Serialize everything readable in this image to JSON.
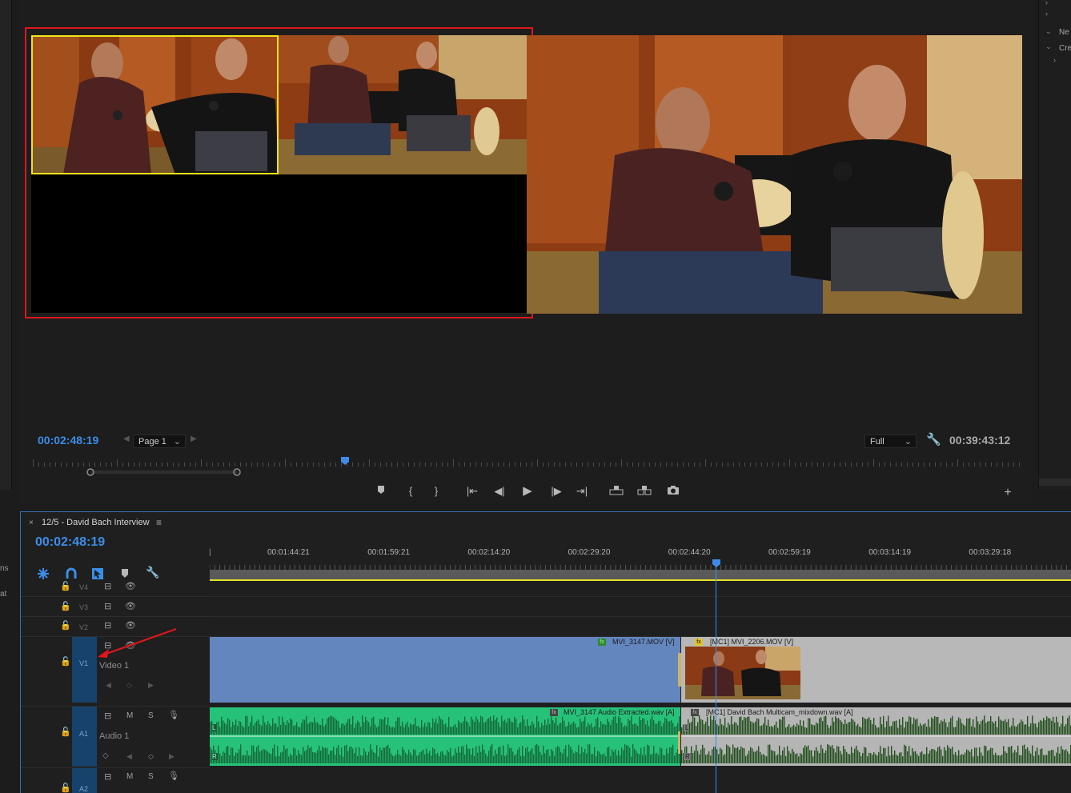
{
  "right_panel": {
    "items": [
      {
        "label": "Ne"
      },
      {
        "label": "Cre"
      }
    ]
  },
  "program_monitor": {
    "timecode_current": "00:02:48:19",
    "timecode_duration": "00:39:43:12",
    "page_select": "Page 1",
    "resolution_select": "Full"
  },
  "timeline": {
    "sequence_name": "12/5 - David Bach Interview",
    "timecode": "00:02:48:19",
    "ruler_labels": [
      "00:01:44:21",
      "00:01:59:21",
      "00:02:14:20",
      "00:02:29:20",
      "00:02:44:20",
      "00:02:59:19",
      "00:03:14:19",
      "00:03:29:18"
    ],
    "tracks": {
      "v4": "V4",
      "v3": "V3",
      "v2": "V2",
      "v1": "V1",
      "v1_name": "Video 1",
      "a1": "A1",
      "a1_name": "Audio 1",
      "a2": "A2",
      "mute": "M",
      "solo": "S"
    },
    "clips": {
      "video_1": "MVI_3147.MOV [V]",
      "video_2": "[MC1] MVI_2206.MOV [V]",
      "audio_1": "MVI_3147 Audio Extracted.wav [A]",
      "audio_2": "[MC1] David Bach Multicam_mixdown.wav [A]",
      "fx": "fx",
      "channel_l": "L",
      "channel_r": "R"
    }
  },
  "side_clips": {
    "a": "ns",
    "b": "at"
  },
  "colors": {
    "accent_blue": "#3b8ee8",
    "selection_red": "#e0161d",
    "active_cam_yellow": "#f0e31a",
    "audio_green": "#27c27a",
    "video_clip_blue": "#6386bf"
  }
}
